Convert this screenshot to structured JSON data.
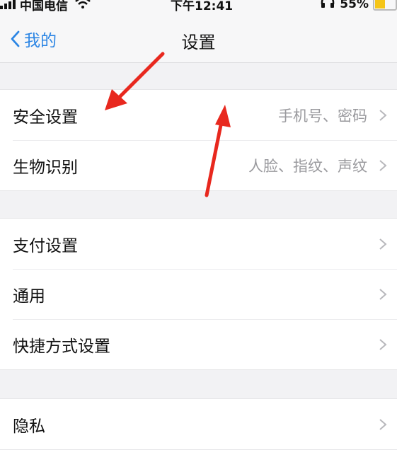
{
  "status_bar": {
    "carrier": "中国电信",
    "time": "下午12:41",
    "battery": "55%",
    "battery_level": 0.55,
    "icons": [
      "signal-icon",
      "wifi-icon",
      "headphones-icon",
      "battery-icon"
    ]
  },
  "nav": {
    "back_label": "我的",
    "title": "设置"
  },
  "groups": [
    {
      "rows": [
        {
          "label": "安全设置",
          "detail": "手机号、密码"
        },
        {
          "label": "生物识别",
          "detail": "人脸、指纹、声纹"
        }
      ]
    },
    {
      "rows": [
        {
          "label": "支付设置",
          "detail": ""
        },
        {
          "label": "通用",
          "detail": ""
        },
        {
          "label": "快捷方式设置",
          "detail": ""
        }
      ]
    },
    {
      "rows": [
        {
          "label": "隐私",
          "detail": ""
        }
      ]
    }
  ],
  "colors": {
    "accent": "#2b85e4",
    "annotation_arrow": "#e8281e",
    "background": "#f2f2f4"
  }
}
